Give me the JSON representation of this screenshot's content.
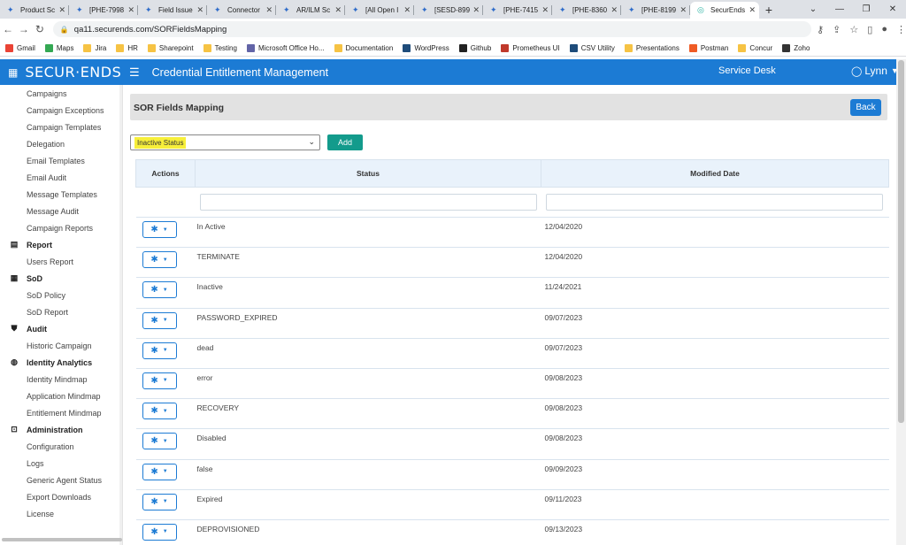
{
  "browser": {
    "tabs": [
      {
        "title": "Product Sc",
        "active": false
      },
      {
        "title": "[PHE-7998",
        "active": false
      },
      {
        "title": "Field Issue",
        "active": false
      },
      {
        "title": "Connector",
        "active": false
      },
      {
        "title": "AR/ILM Sc",
        "active": false
      },
      {
        "title": "[All Open I",
        "active": false
      },
      {
        "title": "[SESD-899",
        "active": false
      },
      {
        "title": "[PHE-7415",
        "active": false
      },
      {
        "title": "[PHE-8360",
        "active": false
      },
      {
        "title": "[PHE-8199",
        "active": false
      },
      {
        "title": "SecurEnds",
        "active": true
      }
    ],
    "url": "qa11.securends.com/SORFieldsMapping",
    "bookmarks": [
      {
        "label": "Gmail",
        "icon": "gmail-icon",
        "color": "#ea4335"
      },
      {
        "label": "Maps",
        "icon": "maps-icon",
        "color": "#34a853"
      },
      {
        "label": "Jira",
        "icon": "folder-icon",
        "color": "#f6c344"
      },
      {
        "label": "HR",
        "icon": "folder-icon",
        "color": "#f6c344"
      },
      {
        "label": "Sharepoint",
        "icon": "folder-icon",
        "color": "#f6c344"
      },
      {
        "label": "Testing",
        "icon": "folder-icon",
        "color": "#f6c344"
      },
      {
        "label": "Microsoft Office Ho...",
        "icon": "office-icon",
        "color": "#6264a7"
      },
      {
        "label": "Documentation",
        "icon": "folder-icon",
        "color": "#f6c344"
      },
      {
        "label": "WordPress",
        "icon": "wordpress-icon",
        "color": "#1e4c7a"
      },
      {
        "label": "Github",
        "icon": "github-icon",
        "color": "#222222"
      },
      {
        "label": "Prometheus UI",
        "icon": "prometheus-icon",
        "color": "#c0392b"
      },
      {
        "label": "CSV Utility",
        "icon": "csv-icon",
        "color": "#1e4c7a"
      },
      {
        "label": "Presentations",
        "icon": "folder-icon",
        "color": "#f6c344"
      },
      {
        "label": "Postman",
        "icon": "postman-icon",
        "color": "#ef5b25"
      },
      {
        "label": "Concur",
        "icon": "concur-icon",
        "color": "#f6c344"
      },
      {
        "label": "Zoho",
        "icon": "zoho-icon",
        "color": "#333333"
      }
    ]
  },
  "header": {
    "logo": "SECUR·ENDS",
    "app_title": "Credential Entitlement Management",
    "service_desk": "Service Desk",
    "user": "Lynn",
    "accent": "#1c7bd4"
  },
  "sidebar": {
    "entries": [
      {
        "type": "item",
        "label": "Campaigns"
      },
      {
        "type": "item",
        "label": "Campaign Exceptions"
      },
      {
        "type": "item",
        "label": "Campaign Templates"
      },
      {
        "type": "item",
        "label": "Delegation"
      },
      {
        "type": "item",
        "label": "Email Templates"
      },
      {
        "type": "item",
        "label": "Email Audit"
      },
      {
        "type": "item",
        "label": "Message Templates"
      },
      {
        "type": "item",
        "label": "Message Audit"
      },
      {
        "type": "item",
        "label": "Campaign Reports"
      },
      {
        "type": "section",
        "label": "Report",
        "icon": "document-icon"
      },
      {
        "type": "item",
        "label": "Users Report"
      },
      {
        "type": "section",
        "label": "SoD",
        "icon": "grid-icon"
      },
      {
        "type": "item",
        "label": "SoD Policy"
      },
      {
        "type": "item",
        "label": "SoD Report"
      },
      {
        "type": "section",
        "label": "Audit",
        "icon": "shield-icon"
      },
      {
        "type": "item",
        "label": "Historic Campaign"
      },
      {
        "type": "section",
        "label": "Identity Analytics",
        "icon": "fingerprint-icon"
      },
      {
        "type": "item",
        "label": "Identity Mindmap"
      },
      {
        "type": "item",
        "label": "Application Mindmap"
      },
      {
        "type": "item",
        "label": "Entitlement Mindmap"
      },
      {
        "type": "section",
        "label": "Administration",
        "icon": "admin-icon"
      },
      {
        "type": "item",
        "label": "Configuration"
      },
      {
        "type": "item",
        "label": "Logs"
      },
      {
        "type": "item",
        "label": "Generic Agent Status"
      },
      {
        "type": "item",
        "label": "Export Downloads"
      },
      {
        "type": "item",
        "label": "License"
      }
    ]
  },
  "main": {
    "title": "SOR Fields Mapping",
    "back_label": "Back",
    "select_value": "Inactive Status",
    "add_label": "Add",
    "add_color": "#139b8c",
    "columns": [
      "Actions",
      "Status",
      "Modified Date"
    ],
    "rows": [
      {
        "status": "In Active",
        "date": "12/04/2020"
      },
      {
        "status": "TERMINATE",
        "date": "12/04/2020"
      },
      {
        "status": "Inactive",
        "date": "11/24/2021"
      },
      {
        "status": "PASSWORD_EXPIRED",
        "date": "09/07/2023"
      },
      {
        "status": "dead",
        "date": "09/07/2023"
      },
      {
        "status": "error",
        "date": "09/08/2023"
      },
      {
        "status": "RECOVERY",
        "date": "09/08/2023"
      },
      {
        "status": "Disabled",
        "date": "09/08/2023"
      },
      {
        "status": "false",
        "date": "09/09/2023"
      },
      {
        "status": "Expired",
        "date": "09/11/2023"
      },
      {
        "status": "DEPROVISIONED",
        "date": "09/13/2023"
      }
    ]
  }
}
